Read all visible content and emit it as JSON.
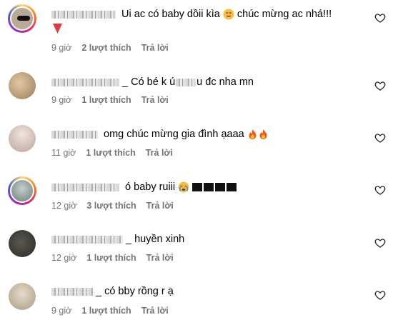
{
  "comments": [
    {
      "text": "Ui ac có baby dồii kìa",
      "text2": "chúc mừng ac nhá!!!",
      "time": "9 giờ",
      "likes": "2 lượt thích",
      "reply": "Trả lời",
      "avatar_color": "#b9aa98",
      "story_ring": true
    },
    {
      "text": "_ Có bé k ú",
      "text2": "u đc nha mn",
      "time": "9 giờ",
      "likes": "1 lượt thích",
      "reply": "Trả lời",
      "avatar_color": "#c6a37f",
      "story_ring": false
    },
    {
      "text": "omg chúc mừng gia đình ạaaa",
      "time": "11 giờ",
      "likes": "1 lượt thích",
      "reply": "Trả lời",
      "avatar_color": "#d8c9c2",
      "story_ring": false
    },
    {
      "text": "ó baby ruiii",
      "time": "12 giờ",
      "likes": "3 lượt thích",
      "reply": "Trả lời",
      "avatar_color": "#9aa7a2",
      "story_ring": true
    },
    {
      "text": "_ huyền xinh",
      "time": "12 giờ",
      "likes": "1 lượt thích",
      "reply": "Trả lời",
      "avatar_color": "#3b3a36",
      "story_ring": false
    },
    {
      "text": "_ có bby rồng r ạ",
      "time": "9 giờ",
      "likes": "1 lượt thích",
      "reply": "Trả lời",
      "avatar_color": "#cfc4b0",
      "story_ring": false
    }
  ],
  "icons": {
    "like": "heart-outline-icon",
    "heart_eyes": "heart-eyes-emoji",
    "fire": "fire-emoji",
    "crying": "crying-emoji",
    "red_flag": "down-arrow-heart-sticker"
  }
}
